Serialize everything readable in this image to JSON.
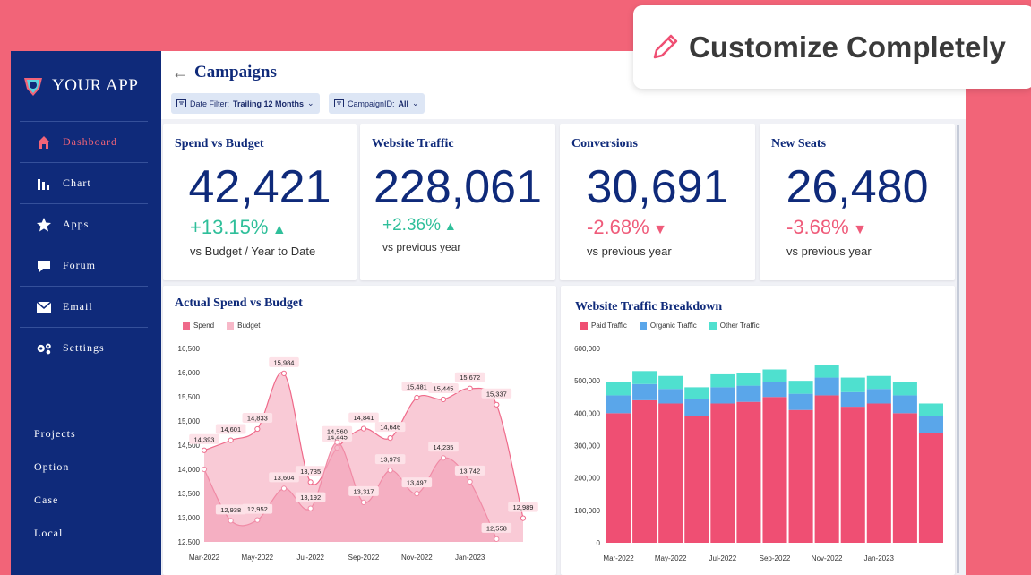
{
  "sidebar": {
    "app_name": "YOUR APP",
    "items": [
      {
        "label": "Dashboard",
        "icon": "home-icon",
        "active": true
      },
      {
        "label": "Chart",
        "icon": "bar-chart-icon"
      },
      {
        "label": "Apps",
        "icon": "star-icon"
      },
      {
        "label": "Forum",
        "icon": "chat-icon"
      },
      {
        "label": "Email",
        "icon": "mail-icon"
      },
      {
        "label": "Settings",
        "icon": "gears-icon"
      }
    ],
    "secondary": [
      "Projects",
      "Option",
      "Case",
      "Local"
    ]
  },
  "header": {
    "title": "Campaigns",
    "filters": [
      {
        "label": "Date Filter:",
        "value": "Trailing 12 Months"
      },
      {
        "label": "CampaignID:",
        "value": "All"
      }
    ]
  },
  "kpis": [
    {
      "title": "Spend vs Budget",
      "value": "42,421",
      "change": "+13.15%",
      "direction": "up",
      "sub": "vs Budget / Year to Date"
    },
    {
      "title": "Website Traffic",
      "value": "228,061",
      "change": "+2.36%",
      "direction": "up",
      "sub": "vs previous year"
    },
    {
      "title": "Conversions",
      "value": "30,691",
      "change": "-2.68%",
      "direction": "down",
      "sub": "vs previous year"
    },
    {
      "title": "New Seats",
      "value": "26,480",
      "change": "-3.68%",
      "direction": "down",
      "sub": "vs previous year"
    }
  ],
  "callout": {
    "text": "Customize Completely",
    "icon": "pencil-icon"
  },
  "colors": {
    "navy": "#0f2a7a",
    "pink": "#f26478",
    "spend": "#ef6a8a",
    "budget": "#f7b8c8",
    "paid": "#ef4f73",
    "organic": "#5aa6ea",
    "other": "#4fe0cf"
  },
  "chart_data": [
    {
      "type": "area",
      "title": "Actual Spend vs Budget",
      "legend": [
        "Spend",
        "Budget"
      ],
      "ylim": [
        12500,
        16500
      ],
      "yticks": [
        "16,500",
        "16,000",
        "15,500",
        "15,000",
        "14,500",
        "14,000",
        "13,500",
        "13,000",
        "12,500"
      ],
      "xticks": [
        "Mar-2022",
        "May-2022",
        "Jul-2022",
        "Sep-2022",
        "Nov-2022",
        "Jan-2023"
      ],
      "spend": {
        "points": [
          [
            0,
            14393
          ],
          [
            1,
            14601
          ],
          [
            2,
            14833
          ],
          [
            3,
            15984
          ],
          [
            4,
            13735
          ],
          [
            5,
            14445
          ],
          [
            6,
            14841
          ],
          [
            7,
            14646
          ],
          [
            8,
            15481
          ],
          [
            9,
            15445
          ],
          [
            10,
            15672
          ],
          [
            11,
            15337
          ],
          [
            12,
            12989
          ]
        ],
        "labels": [
          "14,393",
          "14,601",
          "14,833",
          "15,984",
          "13,735",
          "14,445",
          "14,841",
          "14,646",
          "15,481",
          "15,445",
          "15,672",
          "15,337",
          "12,989"
        ]
      },
      "budget": {
        "points": [
          [
            0,
            14000
          ],
          [
            1,
            12938
          ],
          [
            2,
            12952
          ],
          [
            3,
            13604
          ],
          [
            4,
            13192
          ],
          [
            5,
            14560
          ],
          [
            6,
            13317
          ],
          [
            7,
            13979
          ],
          [
            8,
            13497
          ],
          [
            9,
            14235
          ],
          [
            10,
            13742
          ],
          [
            11,
            12558
          ]
        ],
        "labels": [
          "",
          "12,938",
          "12,952",
          "13,604",
          "13,192",
          "14,560",
          "13,317",
          "13,979",
          "13,497",
          "14,235",
          "13,742",
          "12,558"
        ]
      }
    },
    {
      "type": "bar",
      "title": "Website Traffic Breakdown",
      "legend": [
        "Paid Traffic",
        "Organic Traffic",
        "Other Traffic"
      ],
      "ylim": [
        0,
        600000
      ],
      "yticks": [
        "600,000",
        "500,000",
        "400,000",
        "300,000",
        "200,000",
        "100,000",
        "0"
      ],
      "xticks": [
        "Mar-2022",
        "May-2022",
        "Jul-2022",
        "Sep-2022",
        "Nov-2022",
        "Jan-2023"
      ],
      "series": [
        {
          "name": "Paid Traffic",
          "values": [
            400000,
            440000,
            430000,
            390000,
            430000,
            435000,
            450000,
            410000,
            455000,
            420000,
            430000,
            400000,
            340000
          ]
        },
        {
          "name": "Organic Traffic",
          "values": [
            55000,
            50000,
            45000,
            55000,
            50000,
            50000,
            45000,
            50000,
            55000,
            45000,
            45000,
            55000,
            50000
          ]
        },
        {
          "name": "Other Traffic",
          "values": [
            40000,
            40000,
            40000,
            35000,
            40000,
            40000,
            40000,
            40000,
            40000,
            45000,
            40000,
            40000,
            40000
          ]
        }
      ]
    }
  ]
}
